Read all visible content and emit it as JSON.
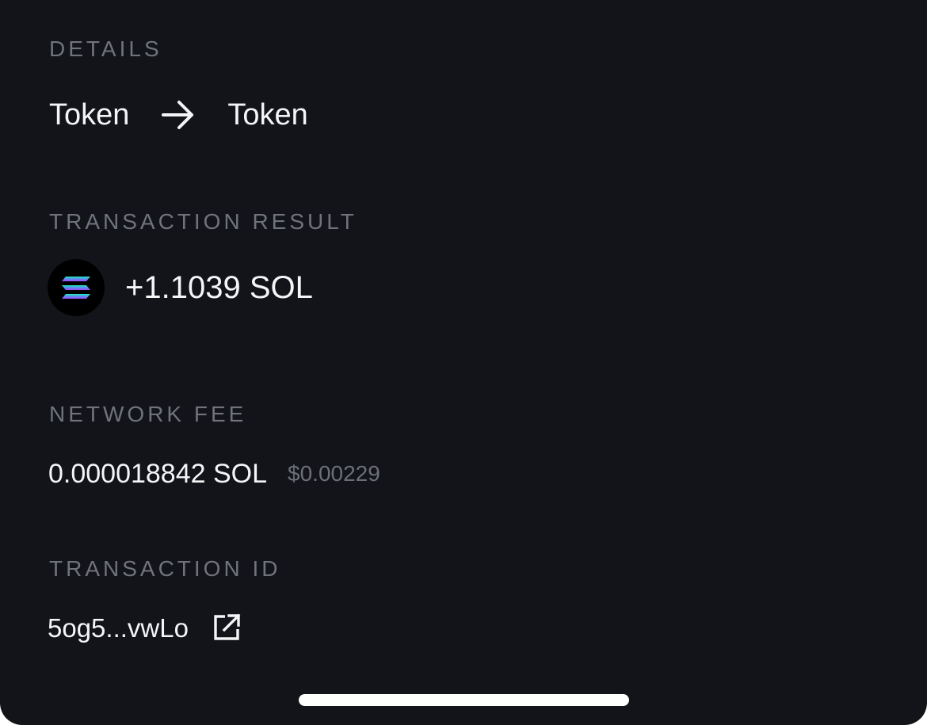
{
  "details": {
    "label": "DETAILS",
    "from_token": "Token",
    "to_token": "Token",
    "arrow_icon": "arrow-right-icon"
  },
  "transaction_result": {
    "label": "TRANSACTION RESULT",
    "token_icon": "solana-icon",
    "amount": "+1.1039 SOL"
  },
  "network_fee": {
    "label": "NETWORK FEE",
    "amount": "0.000018842 SOL",
    "usd_value": "$0.00229"
  },
  "transaction_id": {
    "label": "TRANSACTION ID",
    "value": "5og5...vwLo",
    "link_icon": "external-link-icon"
  },
  "colors": {
    "background": "#121419",
    "label": "#70737c",
    "text": "#f4f5f7",
    "muted": "#6c6f78",
    "solana_gradient": [
      "#14f1c0",
      "#8f4dff"
    ]
  }
}
